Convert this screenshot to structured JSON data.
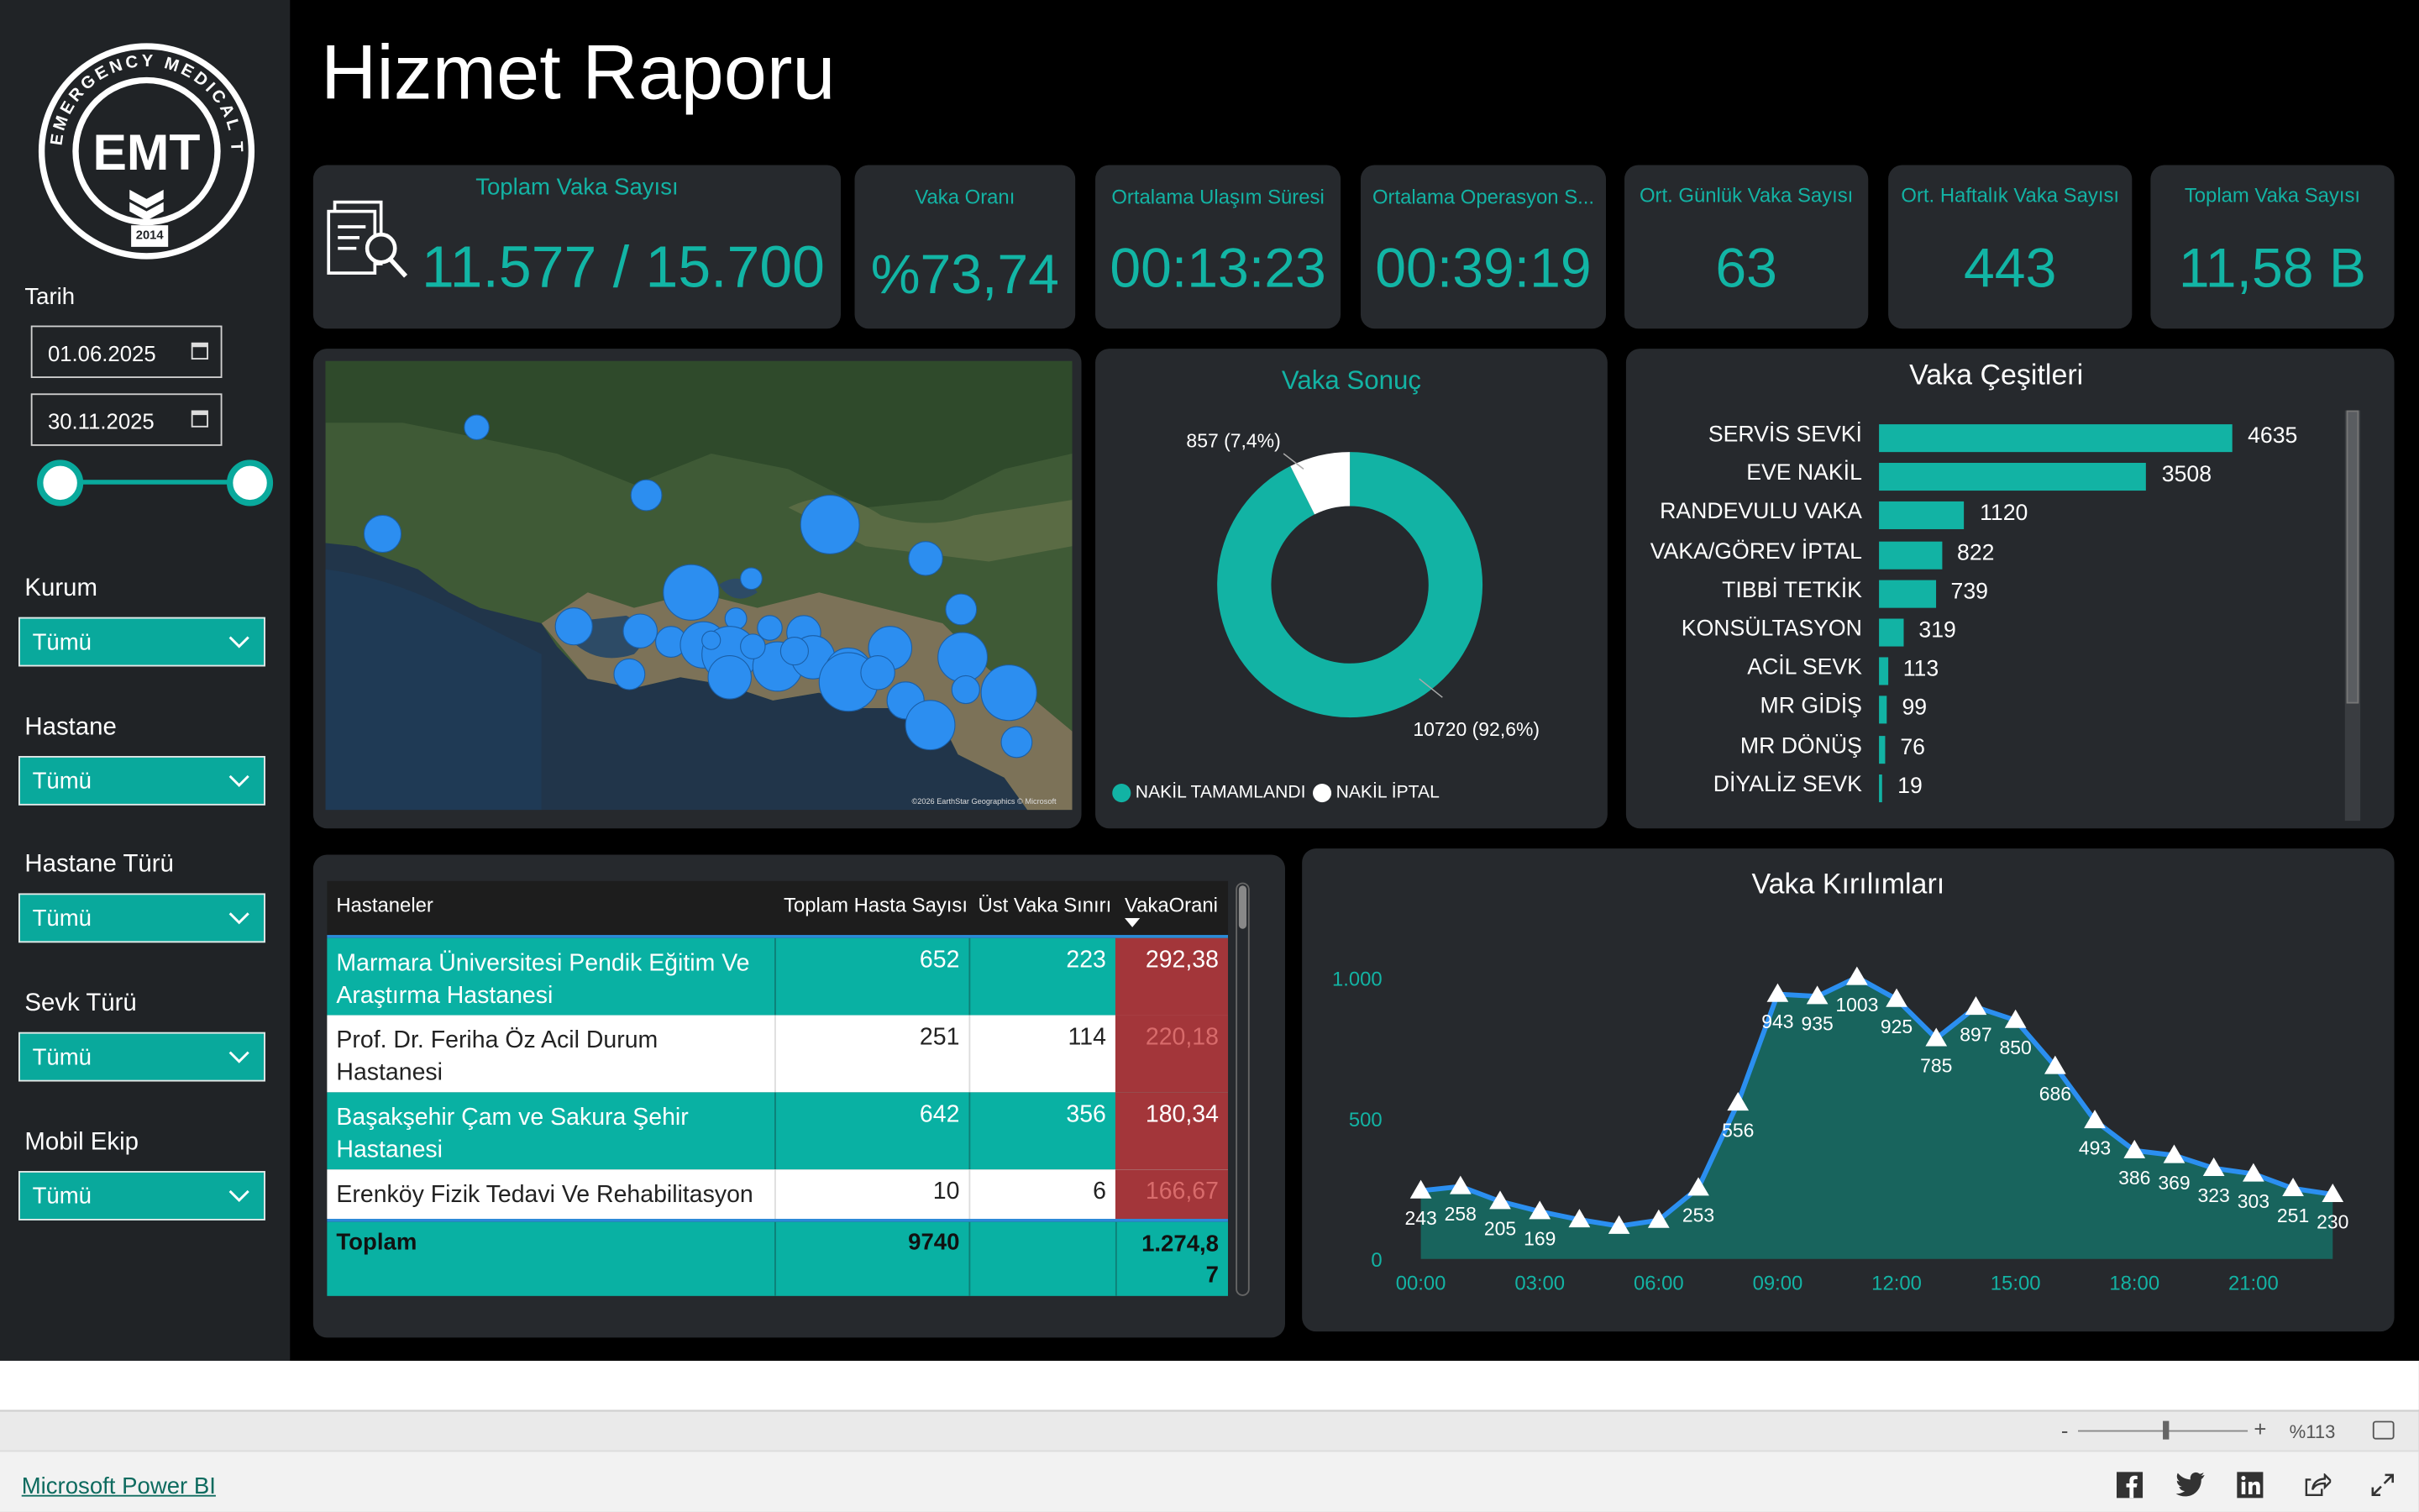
{
  "logo": {
    "ring_text": "EMERGENCY MEDICAL TEAM",
    "center": "EMT",
    "year": "2014"
  },
  "page_title": "Hizmet Raporu",
  "filters": {
    "date_label": "Tarih",
    "date_start": "01.06.2025",
    "date_end": "30.11.2025",
    "kurum": {
      "label": "Kurum",
      "value": "Tümü"
    },
    "hastane": {
      "label": "Hastane",
      "value": "Tümü"
    },
    "hastane_turu": {
      "label": "Hastane Türü",
      "value": "Tümü"
    },
    "sevk_turu": {
      "label": "Sevk Türü",
      "value": "Tümü"
    },
    "mobil_ekip": {
      "label": "Mobil Ekip",
      "value": "Tümü"
    }
  },
  "kpis": [
    {
      "title": "Toplam Vaka Sayısı",
      "value": "11.577 / 15.700"
    },
    {
      "title": "Vaka Oranı",
      "value": "%73,74"
    },
    {
      "title": "Ortalama Ulaşım Süresi",
      "value": "00:13:23"
    },
    {
      "title": "Ortalama Operasyon S...",
      "value": "00:39:19"
    },
    {
      "title": "Ort. Günlük Vaka Sayısı",
      "value": "63"
    },
    {
      "title": "Ort. Haftalık Vaka Sayısı",
      "value": "443"
    },
    {
      "title": "Toplam Vaka Sayısı",
      "value": "11,58 B"
    }
  ],
  "map": {
    "attribution": "©2026 EarthStar Geographics © Microsoft"
  },
  "donut": {
    "title": "Vaka Sonuç",
    "label_small": "857 (7,4%)",
    "label_large": "10720 (92,6%)",
    "legend": [
      "NAKİL TAMAMLANDI",
      "NAKİL İPTAL"
    ],
    "colors": [
      "#12b3a4",
      "#ffffff"
    ]
  },
  "bar_chart": {
    "title": "Vaka Çeşitleri"
  },
  "table": {
    "headers": [
      "Hastaneler",
      "Toplam Hasta Sayısı",
      "Üst Vaka Sınırı",
      "VakaOrani"
    ],
    "rows": [
      {
        "name_l1": "Marmara Üniversitesi Pendik Eğitim Ve",
        "name_l2": "Araştırma Hastanesi",
        "total": "652",
        "limit": "223",
        "ratio": "292,38"
      },
      {
        "name_l1": "Prof. Dr. Feriha Öz Acil Durum",
        "name_l2": "Hastanesi",
        "total": "251",
        "limit": "114",
        "ratio": "220,18"
      },
      {
        "name_l1": "Başakşehir Çam ve Sakura Şehir",
        "name_l2": "Hastanesi",
        "total": "642",
        "limit": "356",
        "ratio": "180,34"
      },
      {
        "name_l1": "Erenköy Fizik Tedavi Ve Rehabilitasyon",
        "name_l2": "",
        "total": "10",
        "limit": "6",
        "ratio": "166,67"
      }
    ],
    "total_label": "Toplam",
    "total_value": "9740",
    "total_ratio_l1": "1.274,8",
    "total_ratio_l2": "7"
  },
  "line_title": "Vaka Kırılımları",
  "zoom": "%113",
  "brand": "Microsoft Power BI",
  "chart_data": [
    {
      "type": "pie",
      "title": "Vaka Sonuç",
      "categories": [
        "NAKİL TAMAMLANDI",
        "NAKİL İPTAL"
      ],
      "values": [
        10720,
        857
      ],
      "percent": [
        92.6,
        7.4
      ]
    },
    {
      "type": "bar",
      "title": "Vaka Çeşitleri",
      "categories": [
        "SERVİS SEVKİ",
        "EVE NAKİL",
        "RANDEVULU VAKA",
        "VAKA/GÖREV İPTAL",
        "TIBBİ TETKİK",
        "KONSÜLTASYON",
        "ACİL SEVK",
        "MR GİDİŞ",
        "MR DÖNÜŞ",
        "DİYALİZ SEVK"
      ],
      "values": [
        4635,
        3508,
        1120,
        822,
        739,
        319,
        113,
        99,
        76,
        19
      ]
    },
    {
      "type": "area",
      "title": "Vaka Kırılımları",
      "x": [
        "00:00",
        "01:00",
        "02:00",
        "03:00",
        "04:00",
        "05:00",
        "06:00",
        "07:00",
        "08:00",
        "09:00",
        "10:00",
        "11:00",
        "12:00",
        "13:00",
        "14:00",
        "15:00",
        "16:00",
        "17:00",
        "18:00",
        "19:00",
        "20:00",
        "21:00",
        "22:00",
        "23:00"
      ],
      "values": [
        243,
        258,
        205,
        169,
        140,
        117,
        138,
        253,
        556,
        943,
        935,
        1003,
        925,
        785,
        897,
        850,
        686,
        493,
        386,
        369,
        323,
        303,
        251,
        230
      ],
      "labels": [
        "243",
        "258",
        "205",
        "169",
        "",
        "",
        "",
        "253",
        "556",
        "943",
        "935",
        "1003",
        "925",
        "785",
        "897",
        "850",
        "686",
        "493",
        "386",
        "369",
        "323",
        "303",
        "251",
        "230"
      ],
      "x_ticks": [
        "00:00",
        "03:00",
        "06:00",
        "09:00",
        "12:00",
        "15:00",
        "18:00",
        "21:00"
      ],
      "y_ticks": [
        "0",
        "500",
        "1.000"
      ],
      "ylim": [
        0,
        1100
      ]
    }
  ]
}
